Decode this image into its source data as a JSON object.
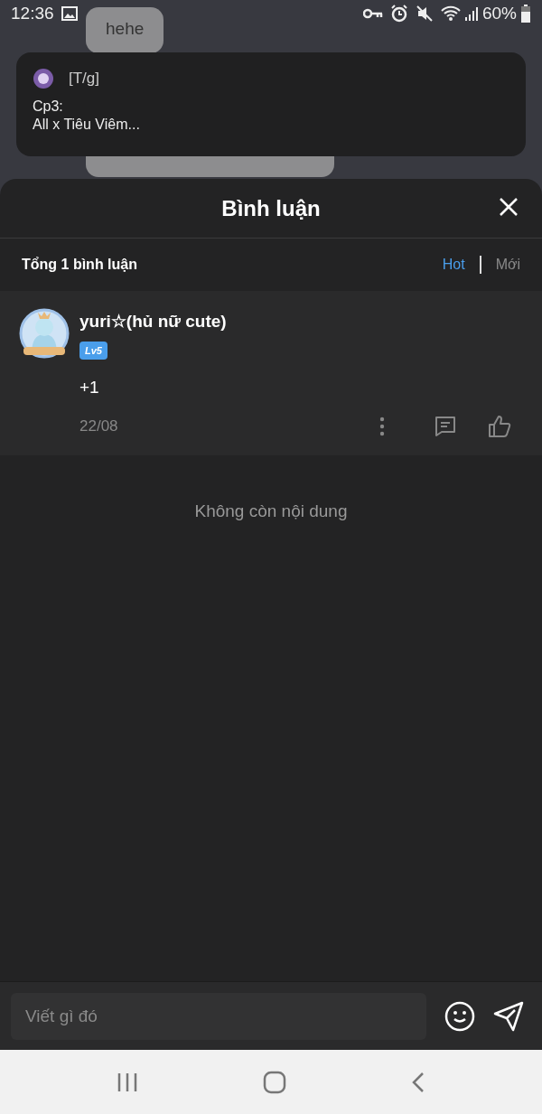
{
  "status_bar": {
    "time": "12:36",
    "battery": "60%"
  },
  "chat": {
    "messages": [
      "hehe"
    ]
  },
  "notification": {
    "title": "[T/g]",
    "body_lines": [
      "Cp3:",
      "All x Tiêu Viêm..."
    ]
  },
  "sheet": {
    "title": "Bình luận",
    "total": "Tổng 1 bình luận",
    "sort_tabs": [
      {
        "label": "Hot",
        "selected": true
      },
      {
        "label": "Mới",
        "selected": false
      }
    ],
    "comments": [
      {
        "user": "yuri☆(hủ nữ cute)",
        "level": "Lv5",
        "text": "+1",
        "date": "22/08"
      }
    ],
    "end_text": "Không còn nội dung"
  },
  "composer": {
    "placeholder": "Viết gì đó"
  }
}
